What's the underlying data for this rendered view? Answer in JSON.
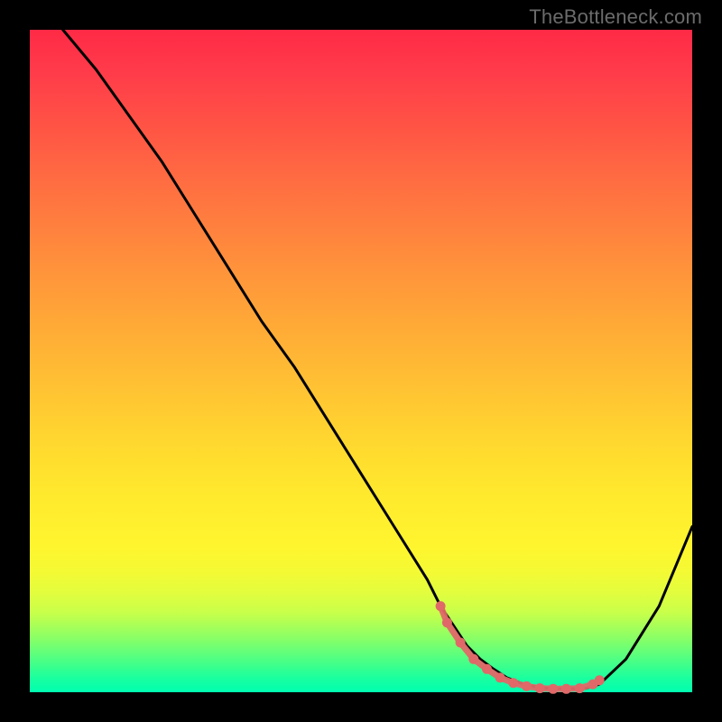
{
  "watermark": "TheBottleneck.com",
  "chart_data": {
    "type": "line",
    "title": "",
    "xlabel": "",
    "ylabel": "",
    "xlim": [
      0,
      100
    ],
    "ylim": [
      0,
      100
    ],
    "grid": false,
    "series": [
      {
        "name": "curve",
        "x": [
          5,
          10,
          15,
          20,
          25,
          30,
          35,
          40,
          45,
          50,
          55,
          60,
          62,
          64,
          66,
          68,
          70,
          72,
          74,
          76,
          78,
          80,
          82,
          84,
          86,
          90,
          95,
          100
        ],
        "y": [
          100,
          94,
          87,
          80,
          72,
          64,
          56,
          49,
          41,
          33,
          25,
          17,
          13,
          10,
          7,
          5,
          3.5,
          2.2,
          1.4,
          0.9,
          0.6,
          0.5,
          0.5,
          0.6,
          1.2,
          5,
          13,
          25
        ]
      }
    ],
    "highlight_points": {
      "x": [
        62,
        63,
        65,
        67,
        69,
        71,
        73,
        75,
        77,
        79,
        81,
        83,
        85,
        86
      ],
      "y": [
        13,
        10.5,
        7.5,
        5,
        3.5,
        2.2,
        1.4,
        0.9,
        0.6,
        0.5,
        0.5,
        0.6,
        1.2,
        1.8
      ]
    },
    "background_gradient": {
      "top": "#ff2a46",
      "bottom": "#00ffb0"
    },
    "highlight_color": "#e06868",
    "curve_color": "#000000"
  }
}
